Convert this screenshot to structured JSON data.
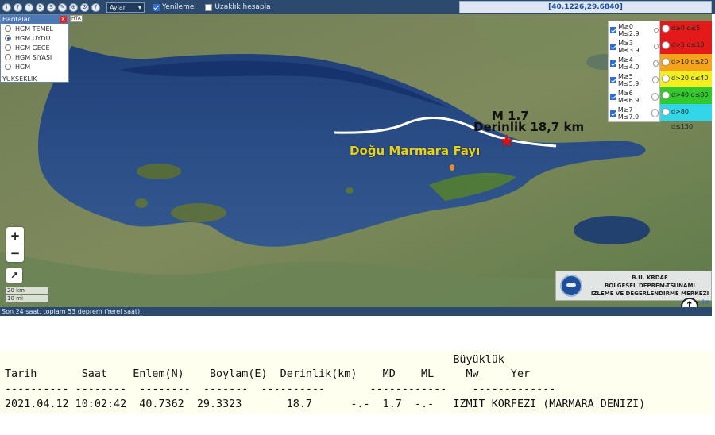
{
  "toolbar": {
    "icons": [
      "info-icon",
      "help-icon",
      "help-icon",
      "list-icon",
      "print-icon",
      "map-icon",
      "globe-icon",
      "settings-icon",
      "help-icon"
    ],
    "icon_glyphs": [
      "i",
      "?",
      "?",
      "9",
      "S",
      "✎",
      "⊕",
      "⚙",
      "?"
    ],
    "period_select": "Aylar",
    "auto_refresh_label": "Yenileme",
    "distance_label": "Uzaklık hesapla",
    "coordinates": "[40.1226,29.6840]"
  },
  "layers_panel": {
    "title": "Haritalar",
    "close": "x",
    "tag": "HTA",
    "items": [
      "HGM TEMEL",
      "HGM UYDU",
      "HGM GECE",
      "HGM SIYASI",
      "HGM"
    ],
    "selected_index": 1,
    "extra": "YUKSEKLIK"
  },
  "magnitude_legend": [
    {
      "label": "M≥0  M≤2.9"
    },
    {
      "label": "M≥3  M≤3.9"
    },
    {
      "label": "M≥4  M≤4.9"
    },
    {
      "label": "M≥5  M≤5.9"
    },
    {
      "label": "M≥6  M≤6.9"
    },
    {
      "label": "M≥7  M≤7.9"
    }
  ],
  "depth_legend": [
    {
      "label": "d≥0  d≤5",
      "color": "#e41a1a"
    },
    {
      "label": "d>5  d≤10",
      "color": "#e41a1a"
    },
    {
      "label": "d>10  d≤20",
      "color": "#f6a21b"
    },
    {
      "label": "d>20  d≤40",
      "color": "#f3ee1d"
    },
    {
      "label": "d>40  d≤80",
      "color": "#33c92d"
    },
    {
      "label": "d>80  d≤150",
      "color": "#31d6e8"
    }
  ],
  "map": {
    "quake_magnitude_label": "M 1.7",
    "quake_depth_label": "Derinlik 18,7 km",
    "fault_label": "Doğu Marmara Fayı",
    "scale": [
      "20 km",
      "10 mi"
    ],
    "zoom_in": "+",
    "zoom_out": "−",
    "expand": "↗",
    "attribution_link": "Le",
    "org": {
      "line1": "B.Ü. KRDAE",
      "line2": "BÖLGESEL DEPREM-TSUNAMİ",
      "line3": "İZLEME VE DEĞERLENDİRME MERKEZİ"
    }
  },
  "status_bar": "Son 24 saat, toplam 53 deprem (Yerel saat).",
  "table": {
    "header_group": "Büyüklük",
    "columns": [
      "Tarih",
      "Saat",
      "Enlem(N)",
      "Boylam(E)",
      "Derinlik(km)",
      "MD",
      "ML",
      "Mw",
      "Yer"
    ],
    "separators": [
      "----------",
      "--------",
      "--------",
      "-------",
      "----------",
      "------------",
      "-------------"
    ],
    "rows": [
      {
        "date": "2021.04.12",
        "time": "10:02:42",
        "lat": "40.7362",
        "lon": "29.3323",
        "depth": "18.7",
        "md": "-.-",
        "ml": "1.7",
        "mw": "-.-",
        "place": "IZMIT KORFEZI (MARMARA DENIZI)"
      }
    ]
  }
}
